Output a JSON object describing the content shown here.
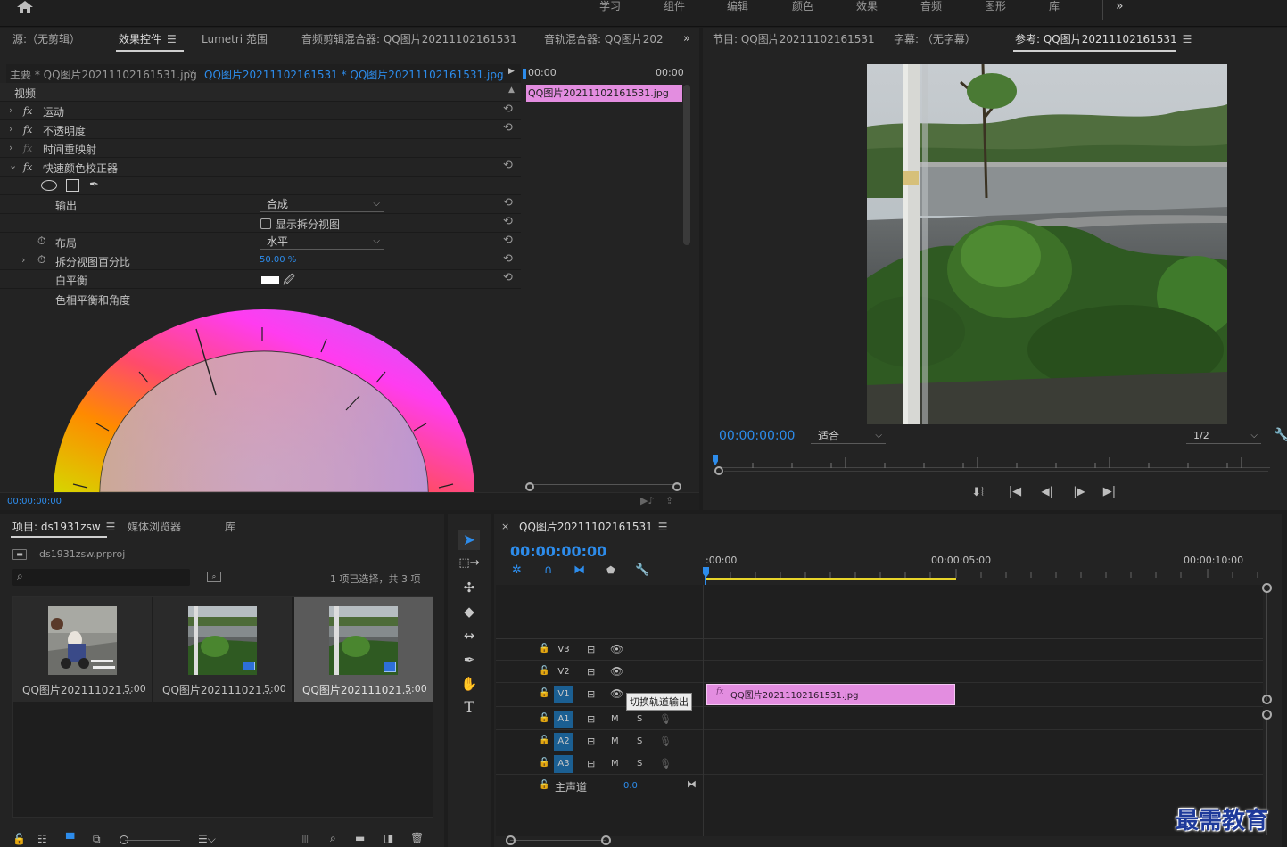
{
  "workspace": {
    "items": [
      "学习",
      "组件",
      "编辑",
      "颜色",
      "效果",
      "音频",
      "图形",
      "库"
    ],
    "more": "»"
  },
  "source_panel": {
    "tabs": [
      "源:（无剪辑）",
      "效果控件",
      "Lumetri 范围",
      "音频剪辑混合器: QQ图片20211102161531",
      "音轨混合器: QQ图片202"
    ],
    "more": "»",
    "clip_master": "主要 * QQ图片20211102161531.jpg",
    "clip_seq": "QQ图片20211102161531 * QQ图片20211102161531.jpg",
    "time_start": "00:00",
    "time_end": "00:00",
    "clip_bar": "QQ图片20211102161531.jpg",
    "section_video": "视频",
    "effects": [
      "运动",
      "不透明度",
      "时间重映射",
      "快速颜色校正器"
    ],
    "output_label": "输出",
    "output_value": "合成",
    "split_view_label": "显示拆分视图",
    "layout_label": "布局",
    "layout_value": "水平",
    "split_percent_label": "拆分视图百分比",
    "split_percent_value": "50.00 %",
    "white_balance_label": "白平衡",
    "hue_balance_label": "色相平衡和角度",
    "timecode": "00:00:00:00"
  },
  "program_panel": {
    "tabs": [
      "节目: QQ图片20211102161531",
      "字幕: （无字幕）",
      "参考: QQ图片20211102161531"
    ],
    "timecode": "00:00:00:00",
    "fit": "适合",
    "resolution": "1/2"
  },
  "project_panel": {
    "tabs": [
      "项目: ds1931zsw",
      "媒体浏览器",
      "库"
    ],
    "file": "ds1931zsw.prproj",
    "search_placeholder": "",
    "selection_info": "1 项已选择，共 3 项",
    "items": [
      {
        "name": "QQ图片2021110​21...",
        "duration": "5:00"
      },
      {
        "name": "QQ图片2021110​21...",
        "duration": "5:00"
      },
      {
        "name": "QQ图片2021110​21...",
        "duration": "5:00"
      }
    ]
  },
  "timeline": {
    "title": "QQ图片20211102161531",
    "timecode": "00:00:00:00",
    "ruler": [
      ":00:00",
      "00:00:05:00",
      "00:00:10:00"
    ],
    "video_tracks": [
      "V3",
      "V2",
      "V1"
    ],
    "audio_tracks": [
      "A1",
      "A2",
      "A3"
    ],
    "master_label": "主声道",
    "master_value": "0.0",
    "clip_label": "QQ图片20211102161531.jpg",
    "tooltip": "切换轨道输出",
    "mute": "M",
    "solo": "S"
  },
  "watermark": "最需教育",
  "colors": {
    "accent_blue": "#2d8ceb",
    "clip_pink": "#e38de0",
    "work_area_yellow": "#e7d42a"
  }
}
